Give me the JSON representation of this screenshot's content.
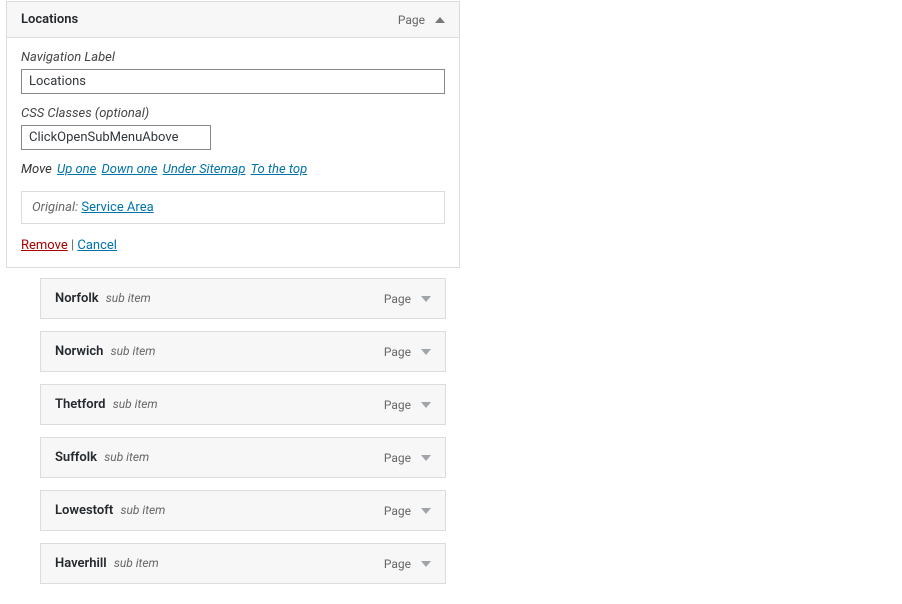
{
  "expandedItem": {
    "title": "Locations",
    "typeLabel": "Page",
    "navLabelCaption": "Navigation Label",
    "navLabelValue": "Locations",
    "cssLabelCaption": "CSS Classes (optional)",
    "cssValue": "ClickOpenSubMenuAbove",
    "moveLabel": "Move",
    "moveLinks": {
      "upOne": "Up one",
      "downOne": "Down one",
      "under": "Under Sitemap",
      "toTop": "To the top"
    },
    "originalLabel": "Original:",
    "originalLink": "Service Area",
    "removeLabel": "Remove",
    "sep": " | ",
    "cancelLabel": "Cancel"
  },
  "subItemSuffix": "sub item",
  "subTypeLabel": "Page",
  "subItems": [
    {
      "title": "Norfolk"
    },
    {
      "title": "Norwich"
    },
    {
      "title": "Thetford"
    },
    {
      "title": "Suffolk"
    },
    {
      "title": "Lowestoft"
    },
    {
      "title": "Haverhill"
    }
  ]
}
